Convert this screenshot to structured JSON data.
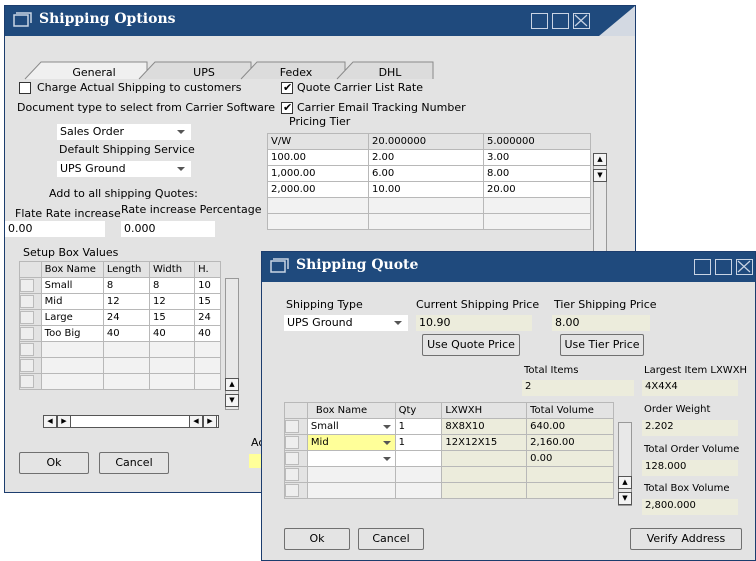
{
  "shipping_options": {
    "title": "Shipping Options",
    "tabs": [
      "General",
      "UPS",
      "Fedex",
      "DHL"
    ],
    "charge_actual": {
      "label": "Charge Actual Shipping to customers",
      "checked": false
    },
    "quote_carrier": {
      "label": "Quote Carrier List Rate",
      "checked": true
    },
    "carrier_email": {
      "label": "Carrier Email Tracking Number",
      "checked": true
    },
    "doc_type_label": "Document type to select from Carrier Software",
    "doc_type_value": "Sales Order",
    "default_service_label": "Default Shipping Service",
    "default_service_value": "UPS Ground",
    "add_all_label": "Add to all shipping Quotes:",
    "flat_rate_label": "Flate Rate increase",
    "flat_rate_value": "0.00",
    "rate_pct_label": "Rate increase Percentage",
    "rate_pct_value": "0.000",
    "pricing_tier_label": "Pricing Tier",
    "pricing_tier": {
      "headers": [
        "V/W",
        "20.000000",
        "5.000000"
      ],
      "rows": [
        [
          "100.00",
          "2.00",
          "3.00"
        ],
        [
          "1,000.00",
          "6.00",
          "8.00"
        ],
        [
          "2,000.00",
          "10.00",
          "20.00"
        ]
      ]
    },
    "setup_box_label": "Setup Box Values",
    "box_grid": {
      "headers": [
        "Box Name",
        "Length",
        "Width",
        "H."
      ],
      "rows": [
        [
          "Small",
          "8",
          "8",
          "10"
        ],
        [
          "Mid",
          "12",
          "12",
          "15"
        ],
        [
          "Large",
          "24",
          "15",
          "24"
        ],
        [
          "Too Big",
          "40",
          "40",
          "40"
        ]
      ]
    },
    "partial_label": "Ac",
    "ok_label": "Ok",
    "cancel_label": "Cancel"
  },
  "shipping_quote": {
    "title": "Shipping Quote",
    "shipping_type_label": "Shipping Type",
    "shipping_type_value": "UPS Ground",
    "current_price_label": "Current Shipping Price",
    "current_price_value": "10.90",
    "tier_price_label": "Tier Shipping Price",
    "tier_price_value": "8.00",
    "use_quote_label": "Use Quote Price",
    "use_tier_label": "Use Tier Price",
    "total_items_label": "Total Items",
    "total_items_value": "2",
    "largest_item_label": "Largest Item LXWXH",
    "largest_item_value": "4X4X4",
    "order_weight_label": "Order Weight",
    "order_weight_value": "2.202",
    "total_order_volume_label": "Total Order Volume",
    "total_order_volume_value": "128.000",
    "total_box_volume_label": "Total Box Volume",
    "total_box_volume_value": "2,800.000",
    "grid": {
      "headers": [
        "Box Name",
        "Qty",
        "LXWXH",
        "Total Volume"
      ],
      "rows": [
        [
          "Small",
          "1",
          "8X8X10",
          "640.00"
        ],
        [
          "Mid",
          "1",
          "12X12X15",
          "2,160.00"
        ],
        [
          "",
          "",
          "",
          "0.00"
        ]
      ]
    },
    "ok_label": "Ok",
    "cancel_label": "Cancel",
    "verify_label": "Verify Address"
  },
  "colors": {
    "titlebar": "#1f4a7d",
    "window_bg": "#e3e3e3",
    "highlight": "#ffff99"
  }
}
